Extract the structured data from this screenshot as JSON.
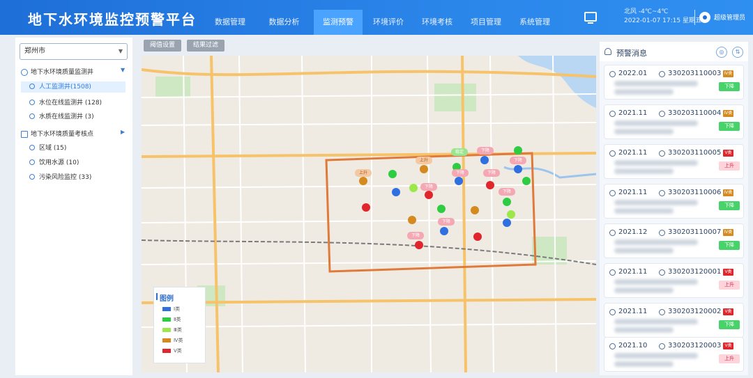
{
  "header": {
    "title": "地下水环境监控预警平台",
    "nav": [
      {
        "label": "数据管理",
        "active": false
      },
      {
        "label": "数据分析",
        "active": false
      },
      {
        "label": "监测预警",
        "active": true
      },
      {
        "label": "环境评价",
        "active": false
      },
      {
        "label": "环境考核",
        "active": false
      },
      {
        "label": "项目管理",
        "active": false
      },
      {
        "label": "系统管理",
        "active": false
      }
    ],
    "weather_line1": "北风 -4℃~4℃",
    "datetime": "2022-01-07 17:15 星期五",
    "user": "超级管理员"
  },
  "sidebar": {
    "city": "郑州市",
    "groups": [
      {
        "label": "地下水环境质量监测井",
        "items": [
          {
            "label": "人工监测井(1508)",
            "selected": true
          },
          {
            "label": "水位在线监测井 (128)",
            "selected": false
          },
          {
            "label": "水质在线监测井 (3)",
            "selected": false
          }
        ]
      },
      {
        "label": "地下水环境质量考核点",
        "items": [
          {
            "label": "区域 (15)",
            "selected": false
          },
          {
            "label": "饮用水源 (10)",
            "selected": false
          },
          {
            "label": "污染风险监控 (33)",
            "selected": false
          }
        ]
      }
    ]
  },
  "toolbar": {
    "threshold": "阈值设置",
    "filter": "结果过滤"
  },
  "legend": {
    "title": "图例",
    "items": [
      {
        "label": "Ⅰ类",
        "color": "#2f6fe0"
      },
      {
        "label": "Ⅱ类",
        "color": "#2ecc40"
      },
      {
        "label": "Ⅲ类",
        "color": "#9be84a"
      },
      {
        "label": "Ⅳ类",
        "color": "#d58a1f"
      },
      {
        "label": "Ⅴ类",
        "color": "#e0262c"
      }
    ]
  },
  "map": {
    "tags": [
      "上升",
      "稳定",
      "下降",
      "上升",
      "下降",
      "下降",
      "下降",
      "下降",
      "下降",
      "下降",
      "下降"
    ]
  },
  "panel": {
    "title": "预警消息",
    "cards": [
      {
        "date": "2022.01",
        "id": "330203110003",
        "grade": "Ⅳ类",
        "grade_color": "#d58a1f",
        "trend": "下降",
        "trend_type": "down"
      },
      {
        "date": "2021.11",
        "id": "330203110004",
        "grade": "Ⅳ类",
        "grade_color": "#d58a1f",
        "trend": "下降",
        "trend_type": "down"
      },
      {
        "date": "2021.11",
        "id": "330203110005",
        "grade": "Ⅴ类",
        "grade_color": "#e0262c",
        "trend": "上升",
        "trend_type": "up"
      },
      {
        "date": "2021.11",
        "id": "330203110006",
        "grade": "Ⅳ类",
        "grade_color": "#d58a1f",
        "trend": "下降",
        "trend_type": "down"
      },
      {
        "date": "2021.12",
        "id": "330203110007",
        "grade": "Ⅳ类",
        "grade_color": "#d58a1f",
        "trend": "下降",
        "trend_type": "down"
      },
      {
        "date": "2021.11",
        "id": "330203120001",
        "grade": "Ⅴ类",
        "grade_color": "#e0262c",
        "trend": "上升",
        "trend_type": "up"
      },
      {
        "date": "2021.11",
        "id": "330203120002",
        "grade": "Ⅴ类",
        "grade_color": "#e0262c",
        "trend": "下降",
        "trend_type": "down"
      },
      {
        "date": "2021.10",
        "id": "330203120003",
        "grade": "Ⅴ类",
        "grade_color": "#e0262c",
        "trend": "上升",
        "trend_type": "up"
      }
    ]
  }
}
